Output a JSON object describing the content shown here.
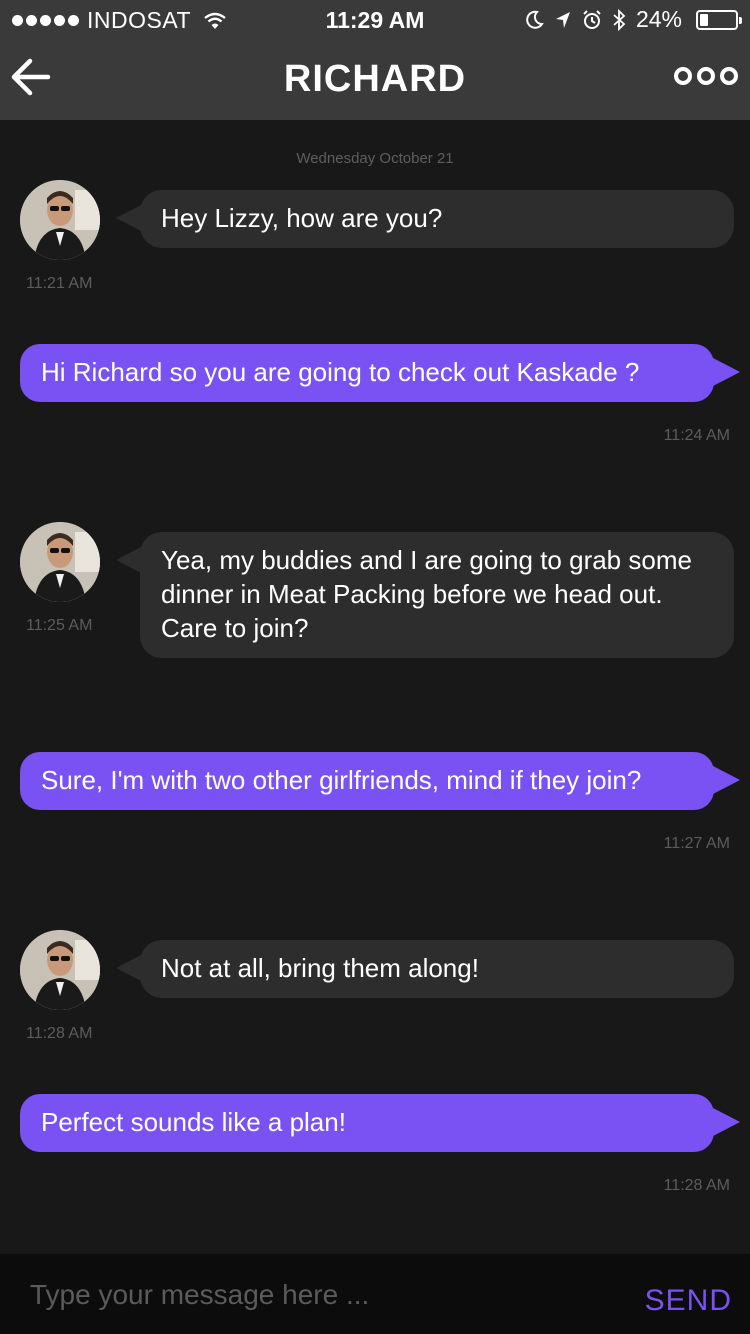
{
  "status_bar": {
    "signal_bars": 5,
    "carrier": "INDOSAT",
    "time": "11:29 AM",
    "battery_percent": "24%",
    "battery_level": 0.24,
    "icons": [
      "wifi-icon",
      "moon-icon",
      "location-arrow-icon",
      "alarm-icon",
      "bluetooth-icon",
      "battery-icon"
    ]
  },
  "nav": {
    "title": "RICHARD",
    "back_icon": "arrow-left-icon",
    "more_icon": "more-dots-icon"
  },
  "date_divider": "Wednesday October 21",
  "messages": [
    {
      "direction": "incoming",
      "text": "Hey Lizzy, how are you?",
      "time": "11:21 AM"
    },
    {
      "direction": "outgoing",
      "text": "Hi Richard so you are going to check out Kaskade ?",
      "time": "11:24 AM"
    },
    {
      "direction": "incoming",
      "text": "Yea, my buddies and I are going to grab some dinner in Meat Packing before we head out. Care to join?",
      "time": "11:25 AM"
    },
    {
      "direction": "outgoing",
      "text": "Sure, I'm with two other girlfriends, mind if they join?",
      "time": "11:27 AM"
    },
    {
      "direction": "incoming",
      "text": "Not at all, bring them along!",
      "time": "11:28 AM"
    },
    {
      "direction": "outgoing",
      "text": "Perfect sounds like a plan!",
      "time": "11:28 AM"
    }
  ],
  "composer": {
    "placeholder": "Type your message here ...",
    "value": "",
    "send_label": "SEND"
  },
  "colors": {
    "accent": "#7a52f4",
    "incoming_bubble": "#2d2d2d",
    "background": "#181818",
    "header": "#3a3a3a"
  }
}
